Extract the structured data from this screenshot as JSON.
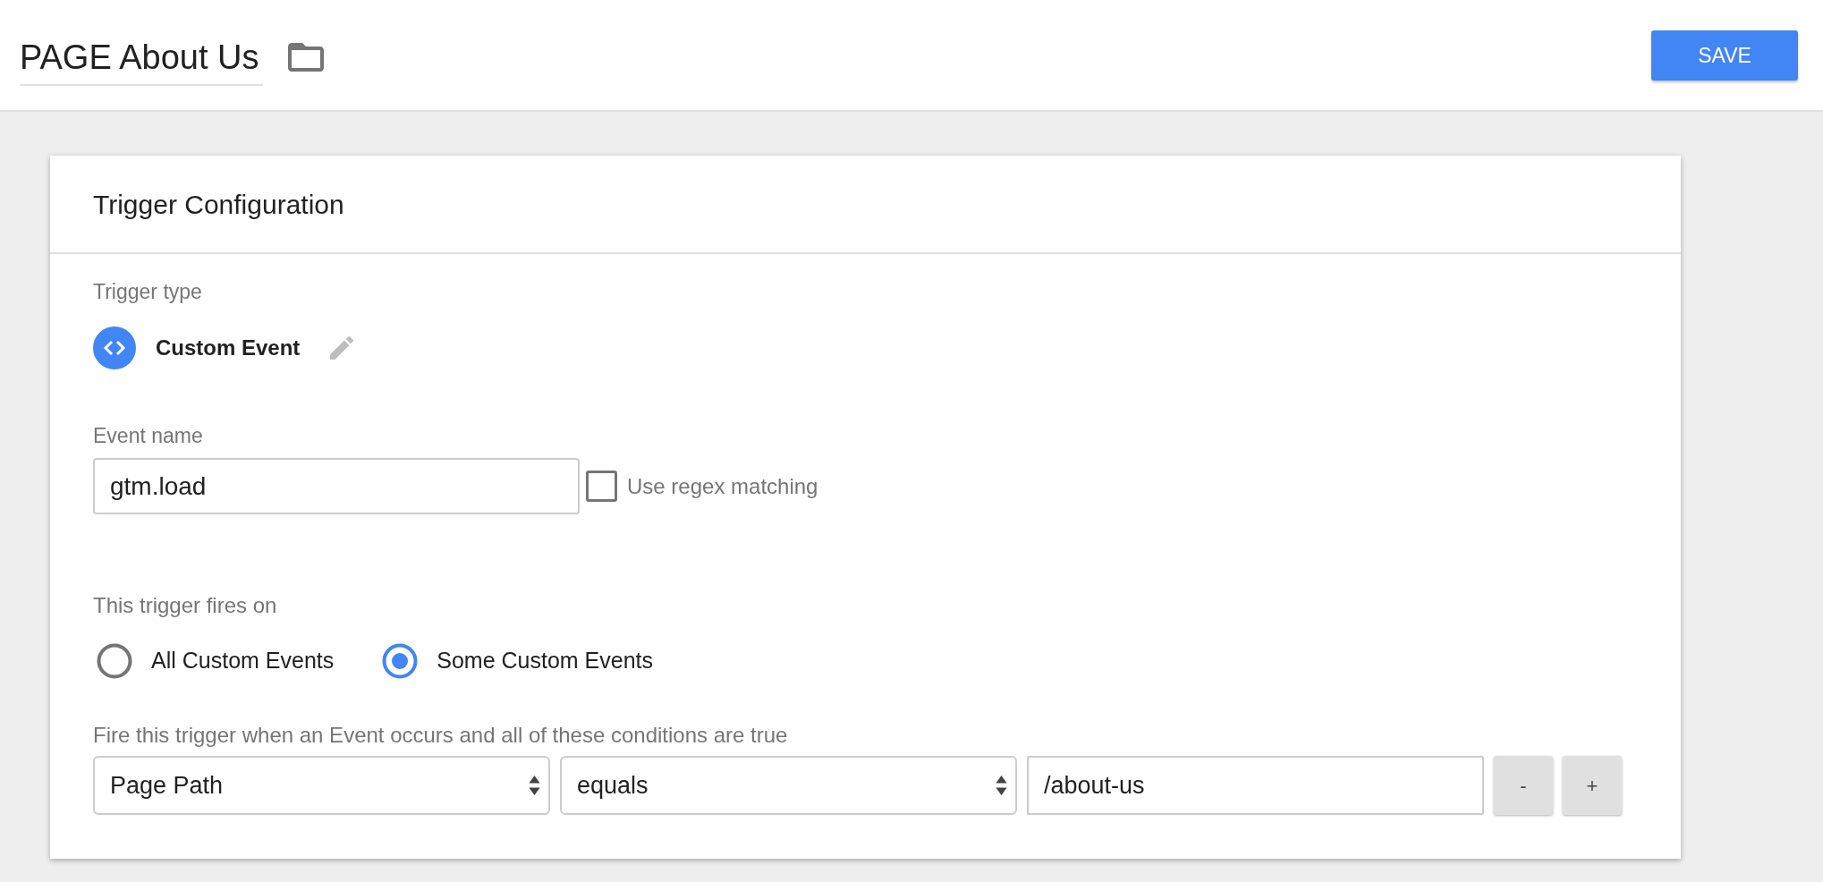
{
  "header": {
    "title": "PAGE About Us",
    "save_button": "SAVE"
  },
  "card": {
    "title": "Trigger Configuration",
    "trigger_type": {
      "label": "Trigger type",
      "value": "Custom Event"
    },
    "event_name": {
      "label": "Event name",
      "value": "gtm.load",
      "regex": {
        "label": "Use regex matching",
        "checked": false
      }
    },
    "fires_on": {
      "label": "This trigger fires on",
      "options": [
        {
          "label": "All Custom Events",
          "selected": false
        },
        {
          "label": "Some Custom Events",
          "selected": true
        }
      ]
    },
    "conditions": {
      "label": "Fire this trigger when an Event occurs and all of these conditions are true",
      "rows": [
        {
          "variable": "Page Path",
          "operator": "equals",
          "value": "/about-us",
          "remove_button": "-",
          "add_button": "+"
        }
      ]
    }
  }
}
